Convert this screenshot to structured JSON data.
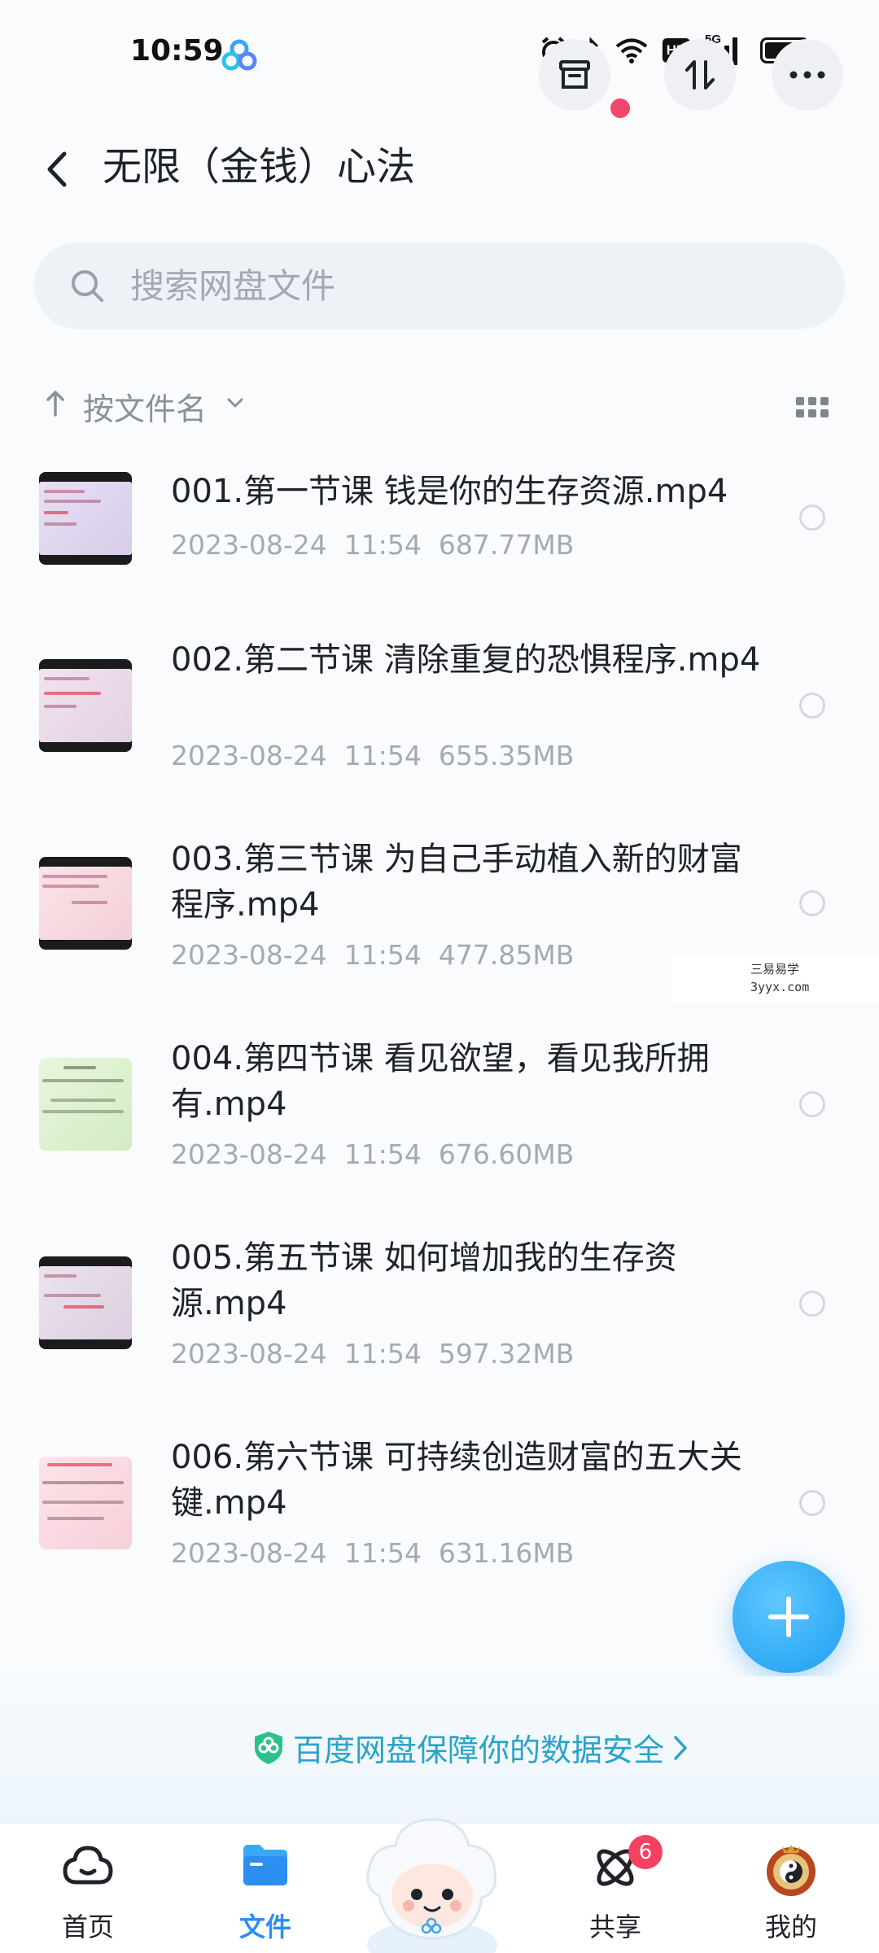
{
  "status_bar": {
    "time": "10:59",
    "network": "5G",
    "hd_label": "HD",
    "icons": [
      "alarm-icon",
      "bluetooth-icon",
      "wifi-icon",
      "hd-icon",
      "signal-icon",
      "battery-icon"
    ]
  },
  "header": {
    "title": "无限（金钱）心法",
    "buttons": [
      "archive-icon",
      "sort-icon",
      "more-icon"
    ]
  },
  "search": {
    "placeholder": "搜索网盘文件"
  },
  "sort": {
    "label": "按文件名",
    "direction": "ascending"
  },
  "files": [
    {
      "name": "001.第一节课 钱是你的生存资源.mp4",
      "date": "2023-08-24",
      "time": "11:54",
      "size": "687.77MB"
    },
    {
      "name": "002.第二节课 清除重复的恐惧程序.mp4",
      "date": "2023-08-24",
      "time": "11:54",
      "size": "655.35MB"
    },
    {
      "name": "003.第三节课 为自己手动植入新的财富程序.mp4",
      "date": "2023-08-24",
      "time": "11:54",
      "size": "477.85MB"
    },
    {
      "name": "004.第四节课 看见欲望，看见我所拥有.mp4",
      "date": "2023-08-24",
      "time": "11:54",
      "size": "676.60MB"
    },
    {
      "name": "005.第五节课 如何增加我的生存资源.mp4",
      "date": "2023-08-24",
      "time": "11:54",
      "size": "597.32MB"
    },
    {
      "name": "006.第六节课 可持续创造财富的五大关键.mp4",
      "date": "2023-08-24",
      "time": "11:54",
      "size": "631.16MB"
    }
  ],
  "watermark": {
    "text": "三易易学",
    "url": "3yyx.com"
  },
  "banner": {
    "text": "百度网盘保障你的数据安全"
  },
  "nav": {
    "home": "首页",
    "files": "文件",
    "share": "共享",
    "share_badge": "6",
    "me": "我的",
    "active": "files"
  },
  "colors": {
    "accent": "#2c8ef0",
    "banner_text": "#2aa3c9",
    "badge": "#f5405f",
    "fab": "#1d9df0"
  }
}
